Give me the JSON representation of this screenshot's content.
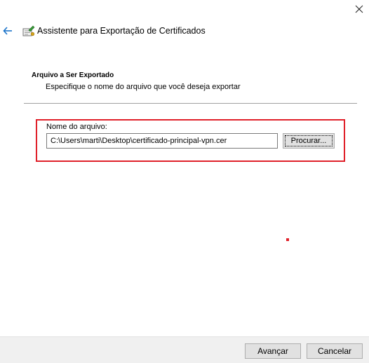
{
  "window": {
    "title": "Assistente para Exportação de Certificados",
    "close_icon": "close-icon",
    "back_icon": "back-arrow-icon",
    "app_icon": "certificate-wizard-icon"
  },
  "section": {
    "heading": "Arquivo a Ser Exportado",
    "description": "Especifique o nome do arquivo que você deseja exportar"
  },
  "file": {
    "label": "Nome do arquivo:",
    "value": "C:\\Users\\marti\\Desktop\\certificado-principal-vpn.cer",
    "browse_label": "Procurar..."
  },
  "footer": {
    "next_label": "Avançar",
    "cancel_label": "Cancelar"
  },
  "colors": {
    "highlight": "#e0202a",
    "back_arrow": "#1a73c9",
    "footer_bg": "#f0f0f0"
  }
}
